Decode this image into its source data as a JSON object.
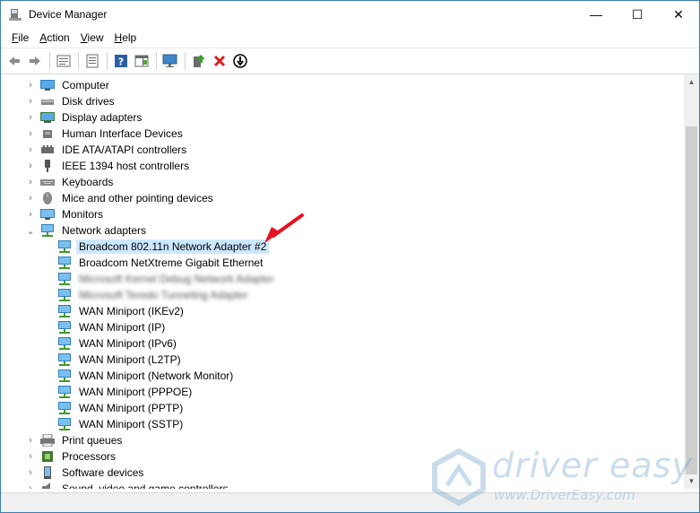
{
  "window": {
    "title": "Device Manager",
    "minimize": "—",
    "maximize": "☐",
    "close": "✕"
  },
  "menu": [
    {
      "accel": "F",
      "rest": "ile"
    },
    {
      "accel": "A",
      "rest": "ction"
    },
    {
      "accel": "V",
      "rest": "iew"
    },
    {
      "accel": "H",
      "rest": "elp"
    }
  ],
  "toolbar": [
    "back-icon",
    "forward-icon",
    "properties-icon",
    "show-hidden-icon",
    "help-icon",
    "action-pane-icon",
    "scan-hardware-icon",
    "update-driver-icon",
    "uninstall-icon",
    "disable-device-icon"
  ],
  "tree": {
    "top_items": [
      "Computer",
      "Disk drives",
      "Display adapters",
      "Human Interface Devices",
      "IDE ATA/ATAPI controllers",
      "IEEE 1394 host controllers",
      "Keyboards",
      "Mice and other pointing devices",
      "Monitors"
    ],
    "expanded_category": "Network adapters",
    "network_children": [
      "Broadcom 802.11n Network Adapter #2",
      "Broadcom NetXtreme Gigabit Ethernet",
      "Microsoft Kernel Debug Network Adapter",
      "Microsoft Teredo Tunneling Adapter",
      "WAN Miniport (IKEv2)",
      "WAN Miniport (IP)",
      "WAN Miniport (IPv6)",
      "WAN Miniport (L2TP)",
      "WAN Miniport (Network Monitor)",
      "WAN Miniport (PPPOE)",
      "WAN Miniport (PPTP)",
      "WAN Miniport (SSTP)"
    ],
    "bottom_items": [
      "Print queues",
      "Processors",
      "Software devices",
      "Sound, video and game controllers"
    ]
  },
  "watermark": {
    "brand": "driver easy",
    "url": "www.DriverEasy.com"
  },
  "colors": {
    "accent": "#e81123",
    "selection": "#cce8ff"
  }
}
